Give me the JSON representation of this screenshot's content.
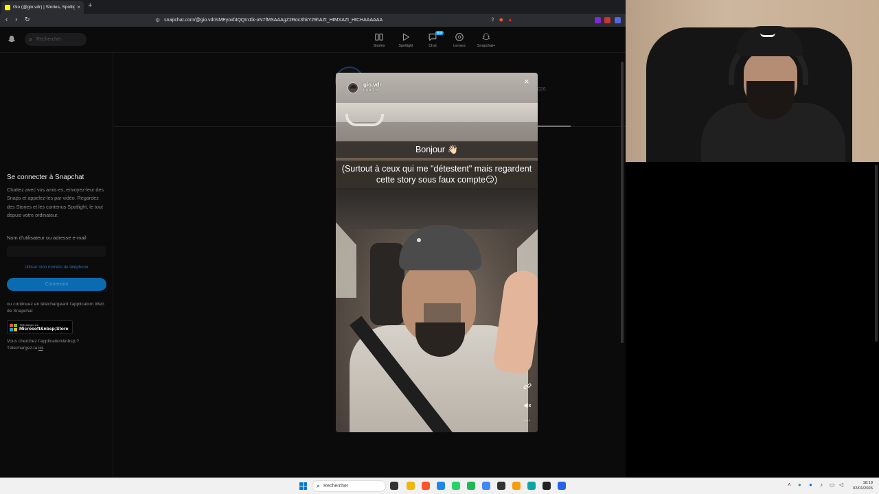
{
  "browser": {
    "tab": {
      "title": "Gio (@gio.vdr) | Stories, Spotlight",
      "close": "×"
    },
    "new_tab": "+",
    "url": "snapchat.com/@gio.vdr/sMEyoxf4QQm1lk-oN7fMSAAAgZ2Roc3hkY29hAZt_HtMXAZt_HtCHAAAAAA",
    "nav": {
      "back": "‹",
      "forward": "›",
      "reload": "↻"
    }
  },
  "snapchat": {
    "search_placeholder": "Rechercher",
    "nav": [
      {
        "label": "Stories",
        "icon": "stories-icon"
      },
      {
        "label": "Spotlight",
        "icon": "spotlight-icon"
      },
      {
        "label": "Chat",
        "icon": "chat-icon",
        "badge": "NEW"
      },
      {
        "label": "Lenses",
        "icon": "lenses-icon"
      },
      {
        "label": "Snapchat+",
        "icon": "snapchat-plus-icon"
      }
    ],
    "sidebar": {
      "title": "Se connecter à Snapchat",
      "description": "Chattez avec vos amis·es, envoyez-leur des Snaps et appelez-les par vidéo. Regardez des Stories et les contenus Spotlight, le tout depuis votre ordinateur.",
      "username_label": "Nom d'utilisateur ou adresse e-mail",
      "use_phone": "Utiliser mon numéro de téléphone",
      "login_button": "Connexion",
      "or_download": "ou continuez en téléchargeant l'application Web de Snapchat",
      "ms_store_small": "Télécharger sur",
      "ms_store_big": "Microsoft&nbsp;Store",
      "looking_for_app": "Vous cherchez l'application&nbsp;?",
      "download_here_prefix": "Téléchargez-la ",
      "download_here_link": "ici",
      "download_here_suffix": "."
    },
    "main": {
      "year_fragment": "026"
    }
  },
  "story": {
    "username": "gio.vdr",
    "time": "Il y a 2 h",
    "caption1": "Bonjour 👋🏻",
    "caption2": "(Surtout à ceux qui me \"détestent\" mais regardent cette story sous faux compte😏)",
    "close": "×",
    "more": "···"
  },
  "taskbar": {
    "search_placeholder": "Rechercher",
    "time": "18:19",
    "date": "02/01/2026",
    "apps": [
      {
        "name": "file-explorer",
        "color": "#f2b705"
      },
      {
        "name": "brave",
        "color": "#fb542b"
      },
      {
        "name": "app-blue",
        "color": "#1e88e5"
      },
      {
        "name": "whatsapp",
        "color": "#25d366"
      },
      {
        "name": "spotify",
        "color": "#1db954"
      },
      {
        "name": "chrome",
        "color": "#4285f4"
      },
      {
        "name": "app-dark",
        "color": "#333333"
      },
      {
        "name": "app-orange",
        "color": "#f59e0b"
      },
      {
        "name": "app-teal",
        "color": "#0ea5a5"
      },
      {
        "name": "app-black",
        "color": "#222222"
      },
      {
        "name": "app-blue2",
        "color": "#2563eb"
      }
    ]
  },
  "colors": {
    "snap_yellow": "#fffc00",
    "login_blue": "#0a6bb0",
    "link_blue": "#2a6fb0"
  }
}
